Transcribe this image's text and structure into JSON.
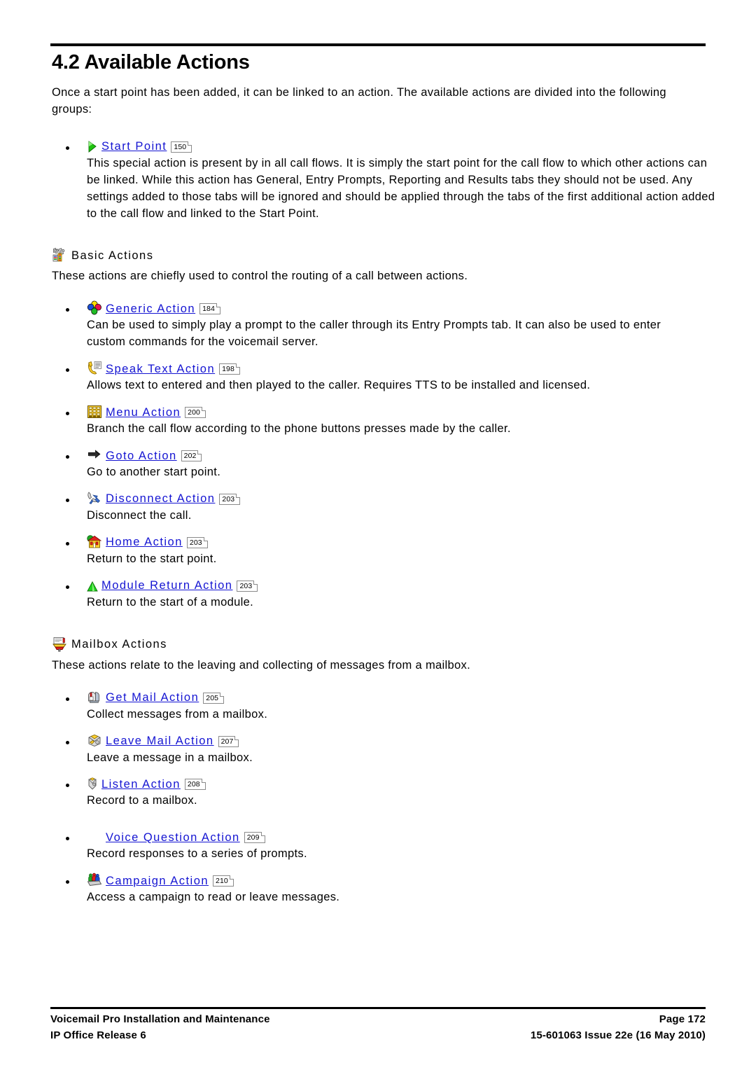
{
  "document": {
    "section_number_title": "4.2 Available Actions",
    "intro": "Once a start point has been added, it can be linked to an action. The available actions are divided into the following groups:"
  },
  "start_point": {
    "icon": "green-play-triangle-icon",
    "label": "Start Point",
    "pageref": "150",
    "description": "This special action is present by in all call flows. It is simply the start point for the call flow to which other actions can be linked. While this action has General, Entry Prompts, Reporting and Results tabs they should not be used. Any settings added to those tabs will be ignored and should be applied through the tabs of the first additional action added to the call flow and linked to the Start Point."
  },
  "basic_actions": {
    "icon": "gear-blocks-icon",
    "title": "Basic Actions",
    "description": "These actions are chiefly used to control the routing of a call between actions.",
    "items": [
      {
        "icon": "generic-clover-icon",
        "label": "Generic Action",
        "pageref": "184",
        "description": "Can be used to simply play a prompt to the caller through its Entry Prompts tab. It can also be used to enter custom commands for the voicemail server."
      },
      {
        "icon": "speak-text-phone-icon",
        "label": "Speak Text Action",
        "pageref": "198",
        "description": "Allows text to entered and then played to the caller. Requires TTS to be installed and licensed."
      },
      {
        "icon": "menu-keypad-icon",
        "label": "Menu Action",
        "pageref": "200",
        "description": "Branch the call flow according to the phone buttons presses made by the caller."
      },
      {
        "icon": "goto-arrow-icon",
        "label": "Goto Action",
        "pageref": "202",
        "description": "Go to another start point."
      },
      {
        "icon": "disconnect-phone-icon",
        "label": "Disconnect Action",
        "pageref": "203",
        "description": "Disconnect the call."
      },
      {
        "icon": "home-house-icon",
        "label": "Home Action",
        "pageref": "203",
        "description": "Return to the start point."
      },
      {
        "icon": "module-return-triangle-icon",
        "label": "Module Return Action",
        "pageref": "203",
        "description": "Return to the start of a module."
      }
    ]
  },
  "mailbox_actions": {
    "icon": "mailbox-tray-icon",
    "title": "Mailbox Actions",
    "description": "These actions relate to the leaving and collecting of messages from a mailbox.",
    "items": [
      {
        "icon": "get-mail-mailbox-icon",
        "label": "Get Mail Action",
        "pageref": "205",
        "description": "Collect messages from a mailbox."
      },
      {
        "icon": "leave-mail-envelope-icon",
        "label": "Leave Mail Action",
        "pageref": "207",
        "description": "Leave a message in a mailbox."
      },
      {
        "icon": "listen-envelope-icon",
        "label": "Listen Action",
        "pageref": "208",
        "description": "Record to a mailbox."
      },
      {
        "icon": "none",
        "label": "Voice Question Action",
        "pageref": "209",
        "description": "Record responses to a series of prompts."
      },
      {
        "icon": "campaign-people-icon",
        "label": "Campaign Action",
        "pageref": "210",
        "description": "Access a campaign to read or leave messages."
      }
    ]
  },
  "footer": {
    "left_line1": "Voicemail Pro Installation and Maintenance",
    "left_line2": "IP Office Release 6",
    "right_line1": "Page 172",
    "right_line2": "15-601063 Issue 22e (16 May 2010)"
  },
  "colors": {
    "link": "#1414d2",
    "text": "#000000",
    "page_background": "#ffffff"
  }
}
